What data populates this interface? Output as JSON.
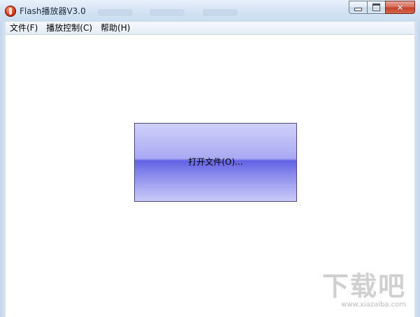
{
  "window": {
    "title": "Flash播放器V3.0",
    "icon": "flash-player-icon",
    "caption_buttons": {
      "minimize_icon": "minimize-icon",
      "maximize_icon": "maximize-icon",
      "close_icon": "close-icon",
      "close_glyph": "✕"
    }
  },
  "menubar": {
    "items": [
      {
        "label": "文件(F)"
      },
      {
        "label": "播放控制(C)"
      },
      {
        "label": "帮助(H)"
      }
    ]
  },
  "main": {
    "open_button_label": "打开文件(O)...",
    "open_button_colors": {
      "top": "#cfcff8",
      "mid": "#6262e4",
      "bottom": "#cacaf7",
      "border": "#4a4a78"
    }
  },
  "watermark": {
    "main": "下载吧",
    "url": "www.xiazaiba.com"
  },
  "colors": {
    "titlebar": "#d6e5f4",
    "close_button": "#c3412b",
    "client_background": "#ffffff"
  }
}
